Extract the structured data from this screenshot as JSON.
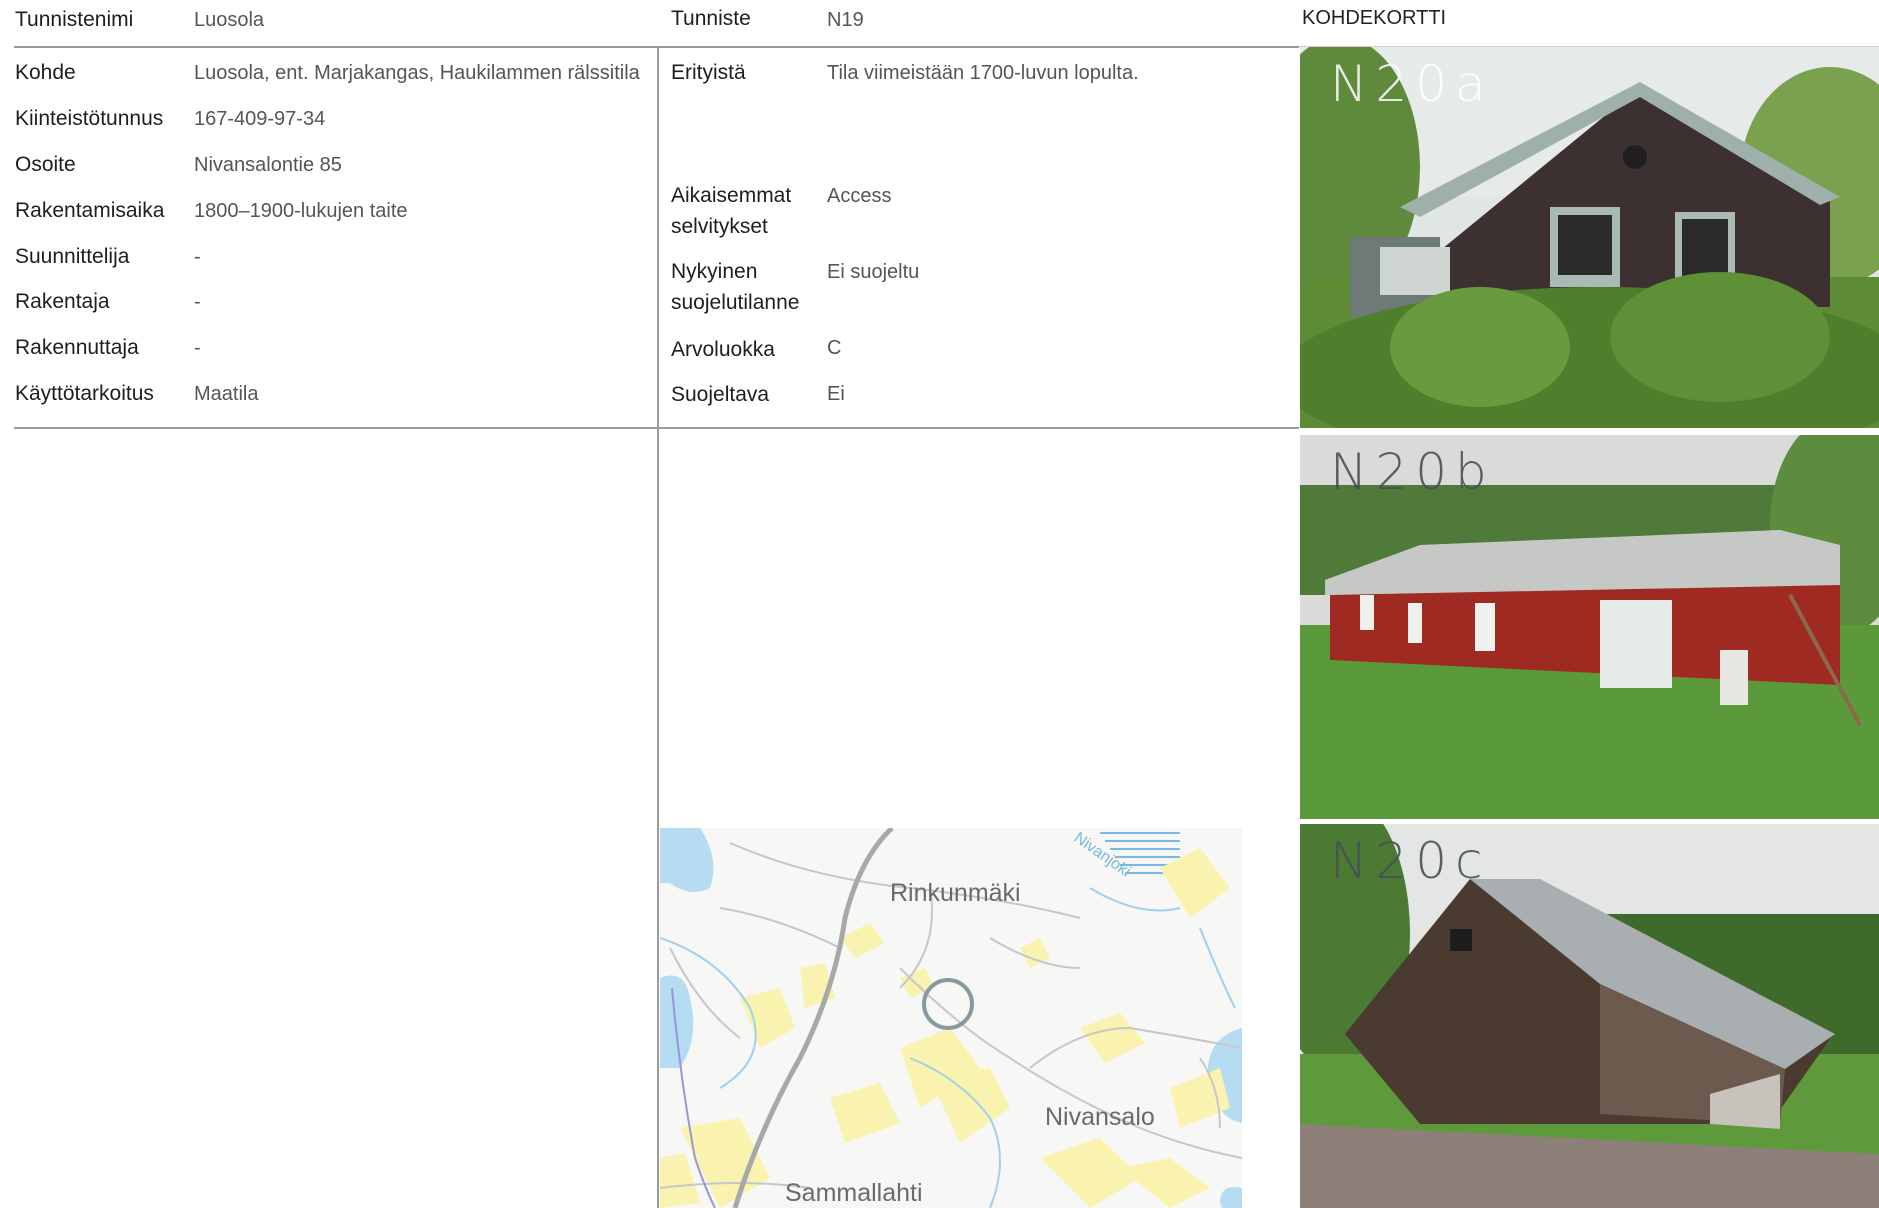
{
  "card_title": "KOHDEKORTTI",
  "left_header": {
    "label": "Tunnistenimi",
    "value": "Luosola"
  },
  "middle_header": {
    "label": "Tunniste",
    "value": "N19"
  },
  "left_fields": [
    {
      "label": "Kohde",
      "value": "Luosola, ent. Marjakangas, Haukilammen rälssitila"
    },
    {
      "label": "Kiinteistötunnus",
      "value": "167-409-97-34"
    },
    {
      "label": "Osoite",
      "value": "Nivansalontie 85"
    },
    {
      "label": "Rakentamisaika",
      "value": "1800–1900-lukujen taite"
    },
    {
      "label": "Suunnittelija",
      "value": "-"
    },
    {
      "label": "Rakentaja",
      "value": "-"
    },
    {
      "label": "Rakennuttaja",
      "value": "-"
    },
    {
      "label": "Käyttötarkoitus",
      "value": "Maatila"
    }
  ],
  "middle_fields": [
    {
      "label": "Erityistä",
      "value": "Tila viimeistään 1700-luvun lopulta."
    },
    {
      "label_line1": "Aikaisemmat",
      "label_line2": "selvitykset",
      "value": "Access"
    },
    {
      "label_line1": "Nykyinen",
      "label_line2": "suojelutilanne",
      "value": "Ei suojeltu"
    },
    {
      "label": "Arvoluokka",
      "value": "C"
    },
    {
      "label": "Suojeltava",
      "value": "Ei"
    }
  ],
  "photos": [
    {
      "label": "N20a",
      "icon": "house-photo"
    },
    {
      "label": "N20b",
      "icon": "barn-photo"
    },
    {
      "label": "N20c",
      "icon": "shed-photo"
    }
  ],
  "map": {
    "places": [
      "Rinkunmäki",
      "Nivansalo",
      "Sammallahti",
      "Nivanjoki"
    ]
  }
}
